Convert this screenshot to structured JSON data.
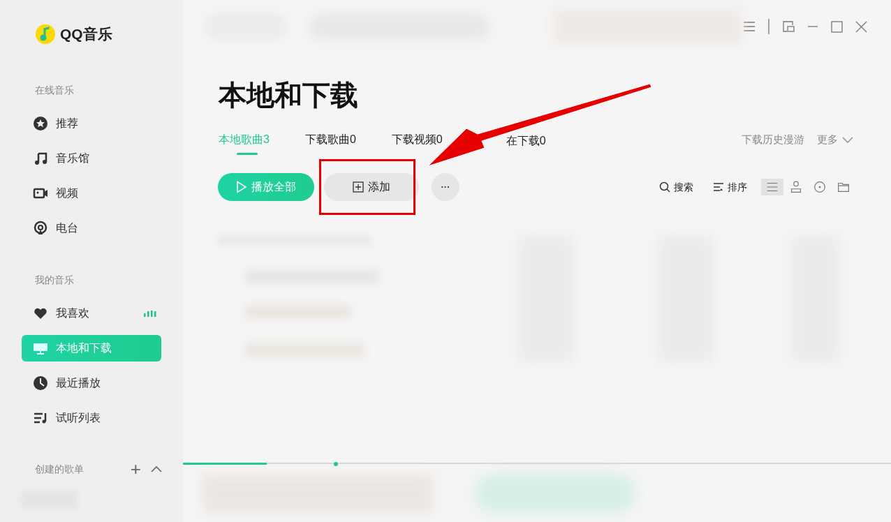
{
  "app": {
    "name": "QQ音乐"
  },
  "sidebar": {
    "sections": [
      {
        "title": "在线音乐",
        "items": [
          {
            "label": "推荐",
            "selected": false
          },
          {
            "label": "音乐馆",
            "selected": false
          },
          {
            "label": "视频",
            "selected": false
          },
          {
            "label": "电台",
            "selected": false
          }
        ]
      },
      {
        "title": "我的音乐",
        "items": [
          {
            "label": "我喜欢",
            "selected": false,
            "playing": true
          },
          {
            "label": "本地和下载",
            "selected": true
          },
          {
            "label": "最近播放",
            "selected": false
          },
          {
            "label": "试听列表",
            "selected": false
          }
        ]
      }
    ],
    "playlists_header": {
      "title": "创建的歌单",
      "add": "+"
    }
  },
  "page": {
    "title": "本地和下载",
    "tabs": [
      {
        "label": "本地歌曲3",
        "selected": true
      },
      {
        "label": "下载歌曲0",
        "selected": false
      },
      {
        "label": "下载视频0",
        "selected": false
      },
      {
        "label": "在下载0",
        "selected": false
      }
    ],
    "links": [
      "下载历史漫游",
      "更多"
    ],
    "toolbar": {
      "play_all": "播放全部",
      "add": "添加",
      "more": "···",
      "search": "搜索",
      "sort": "排序"
    },
    "view_modes": [
      {
        "selected": true
      },
      {
        "selected": false
      },
      {
        "selected": false
      },
      {
        "selected": false
      }
    ]
  },
  "player": {
    "progress": {
      "level": 0.118
    }
  }
}
